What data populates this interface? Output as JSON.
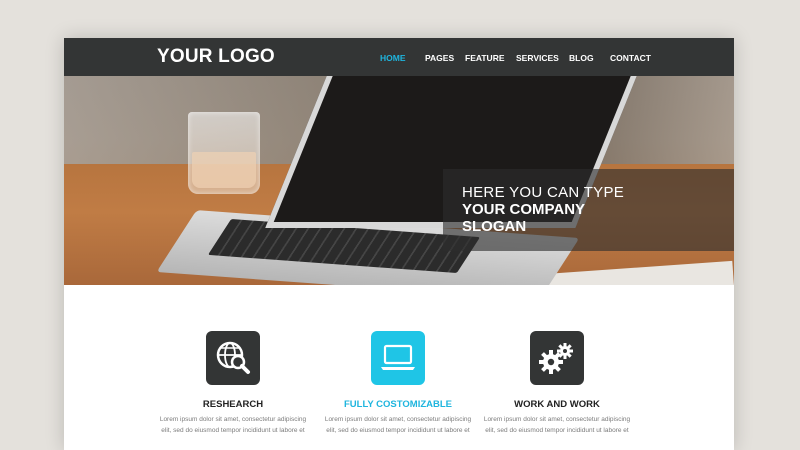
{
  "logo": "YOUR LOGO",
  "nav": {
    "items": [
      {
        "label": "HOME",
        "active": true
      },
      {
        "label": "PAGES",
        "active": false
      },
      {
        "label": "FEATURE",
        "active": false
      },
      {
        "label": "SERVICES",
        "active": false
      },
      {
        "label": "BLOG",
        "active": false
      },
      {
        "label": "CONTACT",
        "active": false
      }
    ]
  },
  "hero": {
    "slogan_line1": "HERE YOU CAN TYPE",
    "slogan_line2": "YOUR COMPANY",
    "slogan_line3": "SLOGAN",
    "slides": 3,
    "active_slide": 2
  },
  "features": [
    {
      "icon": "globe-search-icon",
      "title": "RESHEARCH",
      "desc": "Lorem ipsum dolor sit amet, consectetur adipiscing elit, sed do eiusmod tempor incididunt ut labore et"
    },
    {
      "icon": "laptop-icon",
      "title": "FULLY COSTOMIZABLE",
      "desc": "Lorem ipsum dolor sit amet, consectetur adipiscing elit, sed do eiusmod tempor incididunt ut labore et"
    },
    {
      "icon": "gears-icon",
      "title": "WORK AND WORK",
      "desc": "Lorem ipsum dolor sit amet, consectetur adipiscing elit, sed do eiusmod tempor incididunt ut labore et"
    }
  ],
  "colors": {
    "accent": "#1fb5de",
    "navbar": "#333535",
    "background": "#e4e1dc"
  }
}
